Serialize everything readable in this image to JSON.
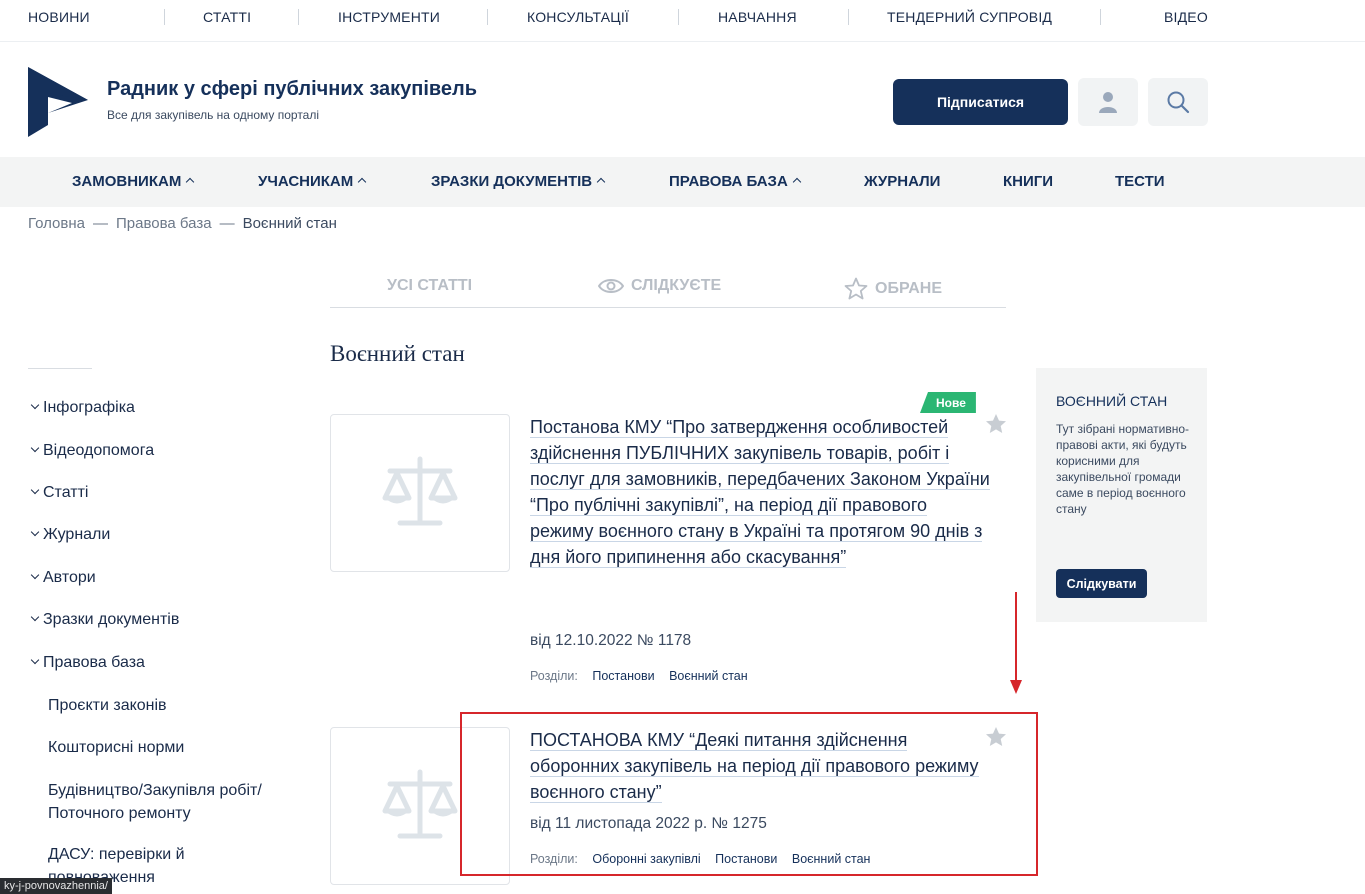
{
  "top_nav": {
    "items": [
      "НОВИНИ",
      "СТАТТІ",
      "ІНСТРУМЕНТИ",
      "КОНСУЛЬТАЦІЇ",
      "НАВЧАННЯ",
      "ТЕНДЕРНИЙ СУПРОВІД",
      "ВІДЕО"
    ]
  },
  "header": {
    "title": "Радник у сфері публічних закупівель",
    "subtitle": "Все для закупівель на одному порталі",
    "subscribe_label": "Підписатися",
    "user_icon": "user-icon",
    "search_icon": "search-icon",
    "brand_color": "#15305a"
  },
  "main_nav": {
    "items": [
      "ЗАМОВНИКАМ",
      "УЧАСНИКАМ",
      "ЗРАЗКИ ДОКУМЕНТІВ",
      "ПРАВОВА БАЗА",
      "ЖУРНАЛИ",
      "КНИГИ",
      "ТЕСТИ"
    ]
  },
  "breadcrumb": {
    "items": [
      "Головна",
      "Правова база",
      "Воєнний стан"
    ],
    "separator": "—"
  },
  "tabs": {
    "all": "УСІ СТАТТІ",
    "following": "СЛІДКУЄТЕ",
    "favorites": "ОБРАНЕ"
  },
  "sidebar": {
    "items": [
      "Інфографіка",
      "Відеодопомога",
      "Статті",
      "Журнали",
      "Автори",
      "Зразки документів",
      "Правова база"
    ],
    "subitems": [
      "Проєкти законів",
      "Кошторисні норми",
      "Будівництво/Закупівля робіт/ Поточного ремонту",
      "ДАСУ: перевірки й повноваження"
    ]
  },
  "page_title": "Воєнний стан",
  "articles": [
    {
      "badge": "Нове",
      "title": "Постанова КМУ “Про затвердження особливостей здійснення ПУБЛІЧНИХ закупівель товарів, робіт і послуг для замовників, передбачених Законом України “Про публічні закупівлі”, на період дії правового режиму воєнного стану в Україні та протягом 90 днів з дня його припинення або скасування”",
      "date": "від 12.10.2022 № 1178",
      "tags_label": "Розділи:",
      "tags": [
        "Постанови",
        "Воєнний стан"
      ]
    },
    {
      "title": "ПОСТАНОВА КМУ “Деякі питання здійснення оборонних закупівель на період дії правового режиму воєнного стану”",
      "date": "від 11 листопада 2022 р. № 1275",
      "tags_label": "Розділи:",
      "tags": [
        "Оборонні закупівлі",
        "Постанови",
        "Воєнний стан"
      ]
    }
  ],
  "infobox": {
    "title": "ВОЄННИЙ СТАН",
    "text": "Тут зібрані нормативно-правові акти, які будуть корисними для закупівельної громади саме в період воєнного стану",
    "button": "Слідкувати"
  },
  "status_url": "ky-j-povnovazhennia/",
  "colors": {
    "accent_red": "#d6262b",
    "badge_green": "#2bb673"
  }
}
